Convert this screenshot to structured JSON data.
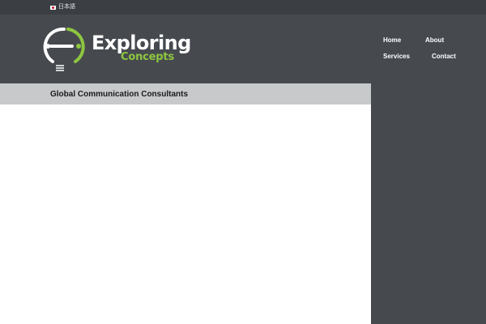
{
  "language_switcher": {
    "flag_icon": "japan-flag-icon",
    "label": "日本語"
  },
  "logo": {
    "word": "Exploring",
    "sub": "Concepts",
    "icon": "lightbulb-logo-icon"
  },
  "nav": {
    "home": "Home",
    "about": "About",
    "services": "Services",
    "contact": "Contact"
  },
  "page": {
    "title": "Global Communication Consultants"
  },
  "colors": {
    "topbar": "#3b3f44",
    "header": "#464a4f",
    "accent": "#8dc63f",
    "title_bar": "#c8c9cb"
  }
}
